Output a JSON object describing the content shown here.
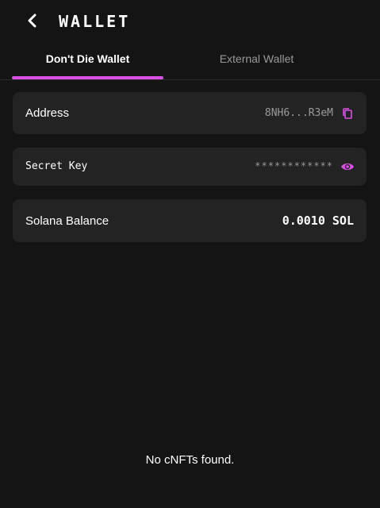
{
  "header": {
    "title": "WALLET",
    "back_icon": "chevron-left-icon"
  },
  "tabs": [
    {
      "label": "Don't Die Wallet",
      "active": true
    },
    {
      "label": "External Wallet",
      "active": false
    }
  ],
  "colors": {
    "accent": "#d94fe6",
    "background": "#141414",
    "card": "#232323"
  },
  "wallet": {
    "address": {
      "label": "Address",
      "value": "8NH6...R3eM",
      "icon": "copy-icon"
    },
    "secret_key": {
      "label": "Secret Key",
      "value": "************",
      "icon": "eye-icon"
    },
    "balance": {
      "label": "Solana Balance",
      "value": "0.0010 SOL"
    }
  },
  "nfts": {
    "empty_text": "No cNFTs found."
  }
}
